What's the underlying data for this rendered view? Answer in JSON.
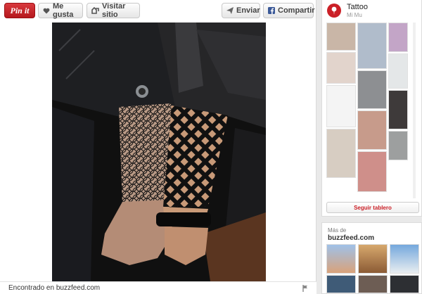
{
  "toolbar": {
    "pin_label": "Pin it",
    "like_label": "Me gusta",
    "visit_label": "Visitar sitio",
    "send_label": "Enviar",
    "share_label": "Compartir"
  },
  "pin": {
    "found_text": "Encontrado en buzzfeed.com"
  },
  "board": {
    "title": "Tattoo",
    "owner": "Mi Mu",
    "follow_label": "Seguir tablero"
  },
  "more_from": {
    "label": "Más de",
    "source": "buzzfeed.com"
  },
  "colors": {
    "pinterest_red": "#cb2027"
  }
}
